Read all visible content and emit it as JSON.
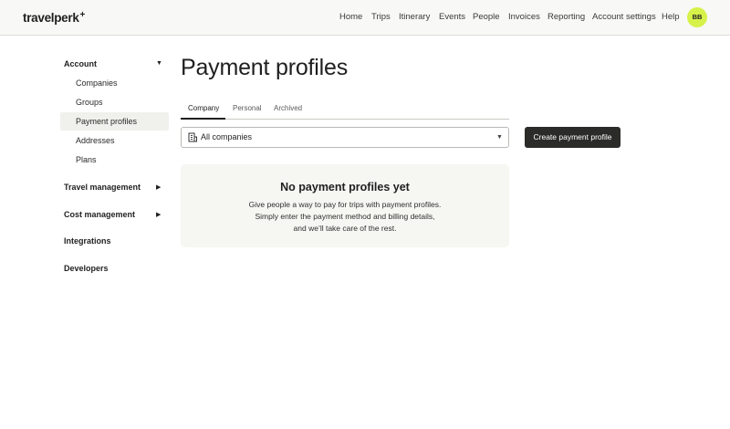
{
  "brand": {
    "name": "travelperk",
    "plus": "+"
  },
  "nav": {
    "items": [
      "Home",
      "Trips",
      "Itinerary",
      "Events",
      "People",
      "Invoices",
      "Reporting",
      "Account settings",
      "Help"
    ],
    "avatar_initials": "BB",
    "avatar_color": "#d6f24a"
  },
  "sidebar": {
    "account": {
      "label": "Account",
      "expanded": true
    },
    "account_items": [
      "Companies",
      "Groups",
      "Payment profiles",
      "Addresses",
      "Plans"
    ],
    "active_item": "Payment profiles",
    "travel_management": {
      "label": "Travel management",
      "expanded": false
    },
    "cost_management": {
      "label": "Cost management",
      "expanded": false
    },
    "integrations": {
      "label": "Integrations"
    },
    "developers": {
      "label": "Developers"
    }
  },
  "page": {
    "title": "Payment profiles"
  },
  "tabs": {
    "items": [
      "Company",
      "Personal",
      "Archived"
    ],
    "active": "Company"
  },
  "company_select": {
    "value": "All companies"
  },
  "create_button": {
    "label": "Create payment profile",
    "color": "#2b2b29"
  },
  "empty_state": {
    "title": "No payment profiles yet",
    "lines": [
      "Give people a way to pay for trips with payment profiles.",
      "Simply enter the payment method and billing details,",
      "and we’ll take care of the rest."
    ]
  }
}
